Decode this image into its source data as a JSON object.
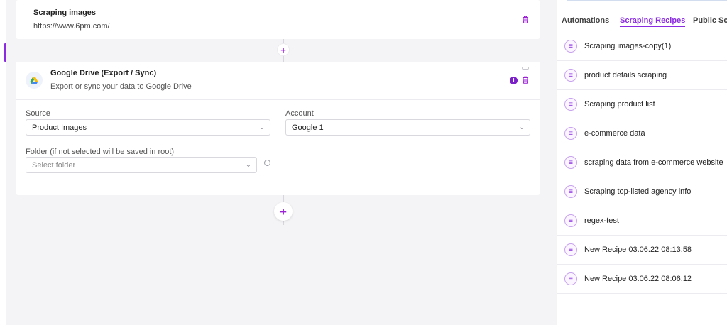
{
  "workflow": {
    "scrape_card": {
      "title": "Scraping images",
      "url": "https://www.6pm.com/"
    },
    "drive_card": {
      "title": "Google Drive (Export / Sync)",
      "subtitle": "Export or sync your data to Google Drive",
      "source": {
        "label": "Source",
        "value": "Product Images"
      },
      "account": {
        "label": "Account",
        "value": "Google 1"
      },
      "folder": {
        "label": "Folder (if not selected will be saved in root)",
        "placeholder": "Select folder"
      }
    },
    "add_symbol": "+"
  },
  "right_panel": {
    "tabs": [
      {
        "label": "Automations",
        "active": false
      },
      {
        "label": "Scraping Recipes",
        "active": true
      },
      {
        "label": "Public Scr",
        "active": false
      }
    ],
    "recipes": [
      "Scraping images-copy(1)",
      "product details scraping",
      "Scraping product list",
      "e-commerce data",
      "scraping data from e-commerce website",
      "Scraping top-listed agency info",
      "regex-test",
      "New Recipe 03.06.22 08:13:58",
      "New Recipe 03.06.22 08:06:12"
    ]
  },
  "icons": {
    "trash": "trash-icon",
    "info": "info-icon",
    "chevron": "chevron-down-icon",
    "drive": "google-drive-icon",
    "recipe": "recipe-list-icon"
  },
  "colors": {
    "accent": "#8a2be2",
    "accent_dark": "#7b1fc9",
    "canvas_bg": "#f4f4f6",
    "card_bg": "#ffffff"
  }
}
